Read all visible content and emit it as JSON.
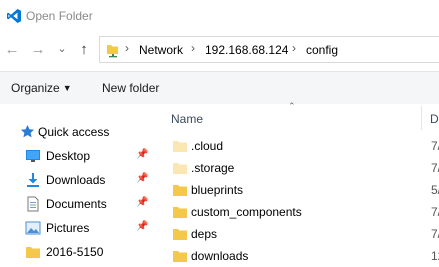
{
  "window": {
    "title": "Open Folder"
  },
  "address": {
    "crumbs": [
      "Network",
      "192.168.68.124",
      "config"
    ]
  },
  "toolbar": {
    "organize_label": "Organize",
    "new_folder_label": "New folder"
  },
  "nav": {
    "quick_access": "Quick access",
    "items": [
      {
        "label": "Desktop",
        "icon": "desktop-icon",
        "pinned": true
      },
      {
        "label": "Downloads",
        "icon": "downloads-icon",
        "pinned": true
      },
      {
        "label": "Documents",
        "icon": "documents-icon",
        "pinned": true
      },
      {
        "label": "Pictures",
        "icon": "pictures-icon",
        "pinned": true
      },
      {
        "label": "2016-5150",
        "icon": "folder-icon",
        "pinned": false
      }
    ]
  },
  "files": {
    "name_header": "Name",
    "date_header": "D",
    "rows": [
      {
        "name": ".cloud",
        "date": "7/",
        "faded": true
      },
      {
        "name": ".storage",
        "date": "7/",
        "faded": true
      },
      {
        "name": "blueprints",
        "date": "5/",
        "faded": false
      },
      {
        "name": "custom_components",
        "date": "7/",
        "faded": false
      },
      {
        "name": "deps",
        "date": "7/",
        "faded": false
      },
      {
        "name": "downloads",
        "date": "12",
        "faded": false
      }
    ]
  },
  "colors": {
    "accent": "#0078d7",
    "folder": "#f4c84a",
    "folder_faded": "#fbe7b3"
  }
}
